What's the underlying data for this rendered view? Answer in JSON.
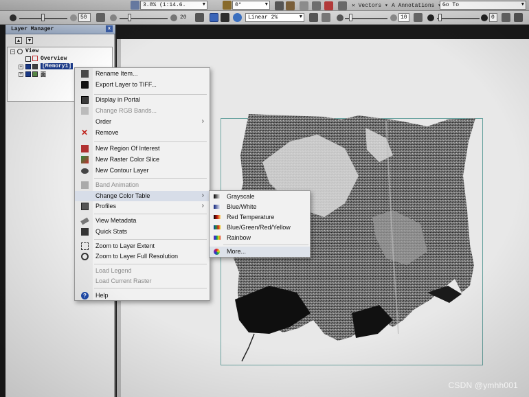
{
  "toolbar1": {
    "zoom_combo": "3.8% (1:14.6.",
    "rotation_combo": "0°",
    "vectors_label": "Vectors",
    "annotations_label": "Annotations",
    "goto_field": "Go To"
  },
  "toolbar2": {
    "brightness_value": "50",
    "contrast_value": "20",
    "stretch_combo": "Linear 2%",
    "sharpen_value": "10",
    "transparency_value": "0"
  },
  "layer_manager": {
    "title": "Layer Manager",
    "tree": {
      "root": "View",
      "overview": "Overview",
      "memory_layer": "[Memory1]",
      "layer2": "面"
    }
  },
  "context_menu": {
    "items": [
      {
        "label": "Rename Item...",
        "icon": "rename-icon",
        "enabled": true
      },
      {
        "label": "Export Layer to TIFF...",
        "icon": "save-icon",
        "enabled": true
      },
      {
        "label": "Display in Portal",
        "icon": "portal-icon",
        "enabled": true
      },
      {
        "label": "Change RGB Bands...",
        "icon": "rgb-bands-icon",
        "enabled": false
      },
      {
        "label": "Order",
        "icon": "none",
        "enabled": true,
        "submenu": true
      },
      {
        "label": "Remove",
        "icon": "remove-icon",
        "enabled": true
      },
      {
        "label": "New Region Of Interest",
        "icon": "roi-icon",
        "enabled": true
      },
      {
        "label": "New Raster Color Slice",
        "icon": "color-slice-icon",
        "enabled": true
      },
      {
        "label": "New Contour Layer",
        "icon": "contour-icon",
        "enabled": true
      },
      {
        "label": "Band Animation",
        "icon": "animation-icon",
        "enabled": false
      },
      {
        "label": "Change Color Table",
        "icon": "none",
        "enabled": true,
        "submenu": true
      },
      {
        "label": "Profiles",
        "icon": "profiles-icon",
        "enabled": true,
        "submenu": true
      },
      {
        "label": "View Metadata",
        "icon": "metadata-icon",
        "enabled": true
      },
      {
        "label": "Quick Stats",
        "icon": "stats-icon",
        "enabled": true
      },
      {
        "label": "Zoom to Layer Extent",
        "icon": "zoom-extent-icon",
        "enabled": true
      },
      {
        "label": "Zoom to Layer Full Resolution",
        "icon": "zoom-full-icon",
        "enabled": true
      },
      {
        "label": "Load Legend",
        "icon": "none",
        "enabled": false
      },
      {
        "label": "Load Current Raster",
        "icon": "none",
        "enabled": false
      },
      {
        "label": "Help",
        "icon": "help-icon",
        "enabled": true
      }
    ]
  },
  "color_table_submenu": {
    "items": [
      {
        "label": "Grayscale",
        "swatch": "grayscale"
      },
      {
        "label": "Blue/White",
        "swatch": "blue-white"
      },
      {
        "label": "Red Temperature",
        "swatch": "red-temperature"
      },
      {
        "label": "Blue/Green/Red/Yellow",
        "swatch": "bgry"
      },
      {
        "label": "Rainbow",
        "swatch": "rainbow"
      },
      {
        "label": "More...",
        "swatch": "more"
      }
    ]
  },
  "watermark": "CSDN @ymhh001",
  "colors": {
    "menu_bg": "#f1f1f1",
    "highlight": "#d7dde8",
    "accent_blue": "#1b3c8e",
    "frame_teal": "#6aa3a0"
  }
}
